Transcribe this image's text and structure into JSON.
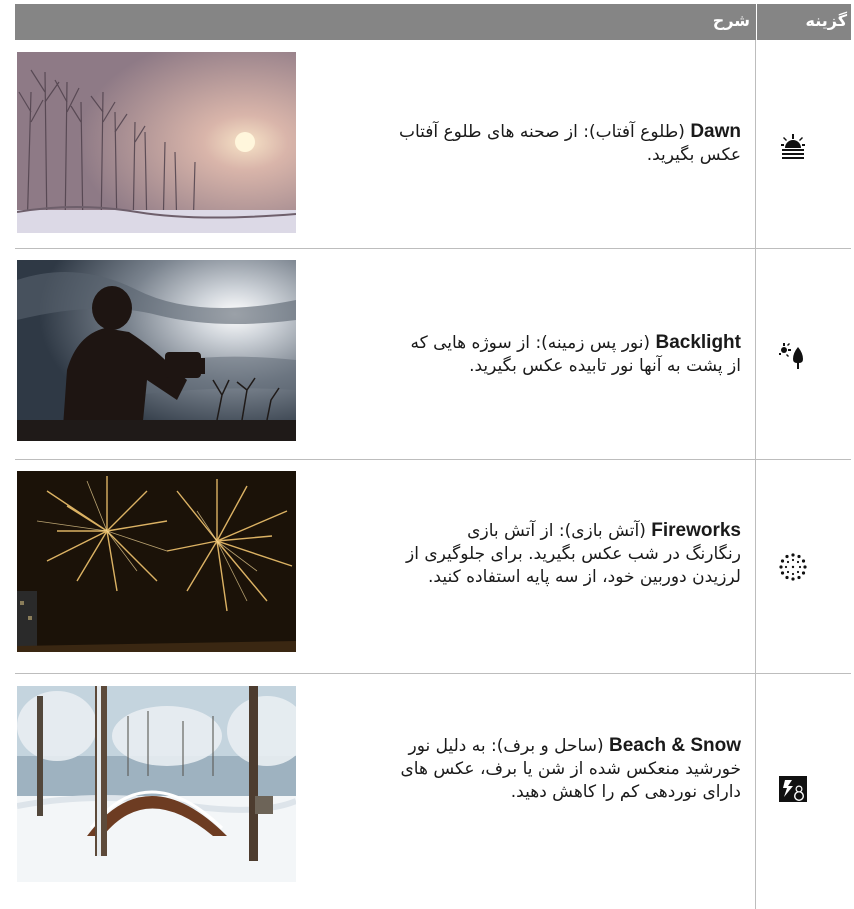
{
  "header": {
    "option": "گزینه",
    "description": "شرح"
  },
  "rows": [
    {
      "name_en": "Dawn",
      "name_fa": "(طلوع آفتاب):",
      "line1_rest": "از صحنه های طلوع آفتاب",
      "line2": "عکس بگیرید.",
      "line3": "",
      "icon": "dawn-icon",
      "photo": "misty sunrise over snowy tree line"
    },
    {
      "name_en": "Backlight",
      "name_fa": "(نور پس زمینه):",
      "line1_rest": "از سوژه هایی که",
      "line2": "از پشت به آنها نور تابیده عکس بگیرید.",
      "line3": "",
      "icon": "backlight-icon",
      "photo": "silhouette of photographer against bright sky"
    },
    {
      "name_en": "Fireworks",
      "name_fa": "(آتش بازی):",
      "line1_rest": "از آتش بازی",
      "line2": "رنگارنگ در شب عکس بگیرید. برای جلوگیری از",
      "line3": "لرزیدن دوربین خود، از سه پایه استفاده کنید.",
      "icon": "fireworks-icon",
      "photo": "golden fireworks bursts at night"
    },
    {
      "name_en": "Beach & Snow",
      "name_fa": "(ساحل و برف):",
      "line1_rest": "به دلیل نور",
      "line2": "خورشید منعکس شده از شن یا برف، عکس های",
      "line3": "دارای نوردهی کم را کاهش دهید.",
      "icon": "beach-snow-icon",
      "photo": "snow covered park with arch sculpture"
    }
  ],
  "colors": {
    "header_bg": "#858585",
    "rule": "#bdbdbd"
  }
}
